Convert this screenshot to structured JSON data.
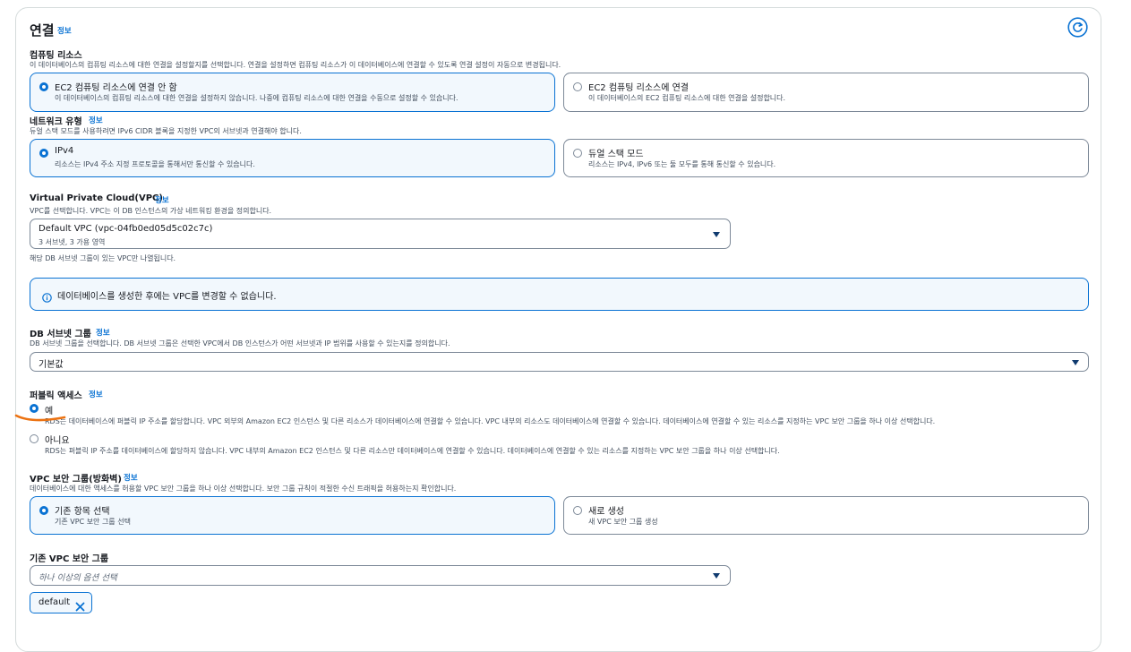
{
  "section": {
    "title": "연결",
    "info": "정보"
  },
  "compute": {
    "label": "컴퓨팅 리소스",
    "desc": "이 데이터베이스의 컴퓨팅 리소스에 대한 연결을 설정할지를 선택합니다. 연결을 설정하면 컴퓨팅 리소스가 이 데이터베이스에 연결할 수 있도록 연결 설정이 자동으로 변경됩니다.",
    "options": [
      {
        "title": "EC2 컴퓨팅 리소스에 연결 안 함",
        "desc": "이 데이터베이스의 컴퓨팅 리소스에 대한 연결을 설정하지 않습니다. 나중에 컴퓨팅 리소스에 대한 연결을 수동으로 설정할 수 있습니다."
      },
      {
        "title": "EC2 컴퓨팅 리소스에 연결",
        "desc": "이 데이터베이스의 EC2 컴퓨팅 리소스에 대한 연결을 설정합니다."
      }
    ]
  },
  "network": {
    "label": "네트워크 유형",
    "info": "정보",
    "desc": "듀얼 스택 모드를 사용하려면 IPv6 CIDR 블록을 지정한 VPC의 서브넷과 연결해야 합니다.",
    "options": [
      {
        "title": "IPv4",
        "desc": "리소스는 IPv4 주소 지정 프로토콜을 통해서만 통신할 수 있습니다."
      },
      {
        "title": "듀얼 스택 모드",
        "desc": "리소스는 IPv4, IPv6 또는 둘 모두를 통해 통신할 수 있습니다."
      }
    ]
  },
  "vpc": {
    "label": "Virtual Private Cloud(VPC)",
    "info": "정보",
    "desc": "VPC를 선택합니다. VPC는 이 DB 인스턴스의 가상 네트워킹 환경을 정의합니다.",
    "value": "Default VPC (vpc-04fb0ed05d5c02c7c)",
    "sub": "3 서브넷, 3 가용 영역",
    "hint": "해당 DB 서브넷 그룹이 있는 VPC만 나열됩니다.",
    "alert": "데이터베이스를 생성한 후에는 VPC를 변경할 수 없습니다."
  },
  "subnet": {
    "label": "DB 서브넷 그룹",
    "info": "정보",
    "desc": "DB 서브넷 그룹을 선택합니다. DB 서브넷 그룹은 선택한 VPC에서 DB 인스턴스가 어떤 서브넷과 IP 범위를 사용할 수 있는지를 정의합니다.",
    "value": "기본값"
  },
  "public": {
    "label": "퍼블릭 액세스",
    "info": "정보",
    "options": [
      {
        "title": "예",
        "desc": "RDS는 데이터베이스에 퍼블릭 IP 주소를 할당합니다. VPC 외부의 Amazon EC2 인스턴스 및 다른 리소스가 데이터베이스에 연결할 수 있습니다. VPC 내부의 리소스도 데이터베이스에 연결할 수 있습니다. 데이터베이스에 연결할 수 있는 리소스를 지정하는 VPC 보안 그룹을 하나 이상 선택합니다."
      },
      {
        "title": "아니요",
        "desc": "RDS는 퍼블릭 IP 주소를 데이터베이스에 할당하지 않습니다. VPC 내부의 Amazon EC2 인스턴스 및 다른 리소스만 데이터베이스에 연결할 수 있습니다. 데이터베이스에 연결할 수 있는 리소스를 지정하는 VPC 보안 그룹을 하나 이상 선택합니다."
      }
    ]
  },
  "sg": {
    "label": "VPC 보안 그룹(방화벽)",
    "info": "정보",
    "desc": "데이터베이스에 대한 액세스를 허용할 VPC 보안 그룹을 하나 이상 선택합니다. 보안 그룹 규칙이 적절한 수신 트래픽을 허용하는지 확인합니다.",
    "options": [
      {
        "title": "기존 항목 선택",
        "desc": "기존 VPC 보안 그룹 선택"
      },
      {
        "title": "새로 생성",
        "desc": "새 VPC 보안 그룹 생성"
      }
    ]
  },
  "existing_sg": {
    "label": "기존 VPC 보안 그룹",
    "placeholder": "하나 이상의 옵션 선택",
    "token": "default"
  },
  "colors": {
    "accent": "#0972d3",
    "annotation": "#ec7211"
  }
}
